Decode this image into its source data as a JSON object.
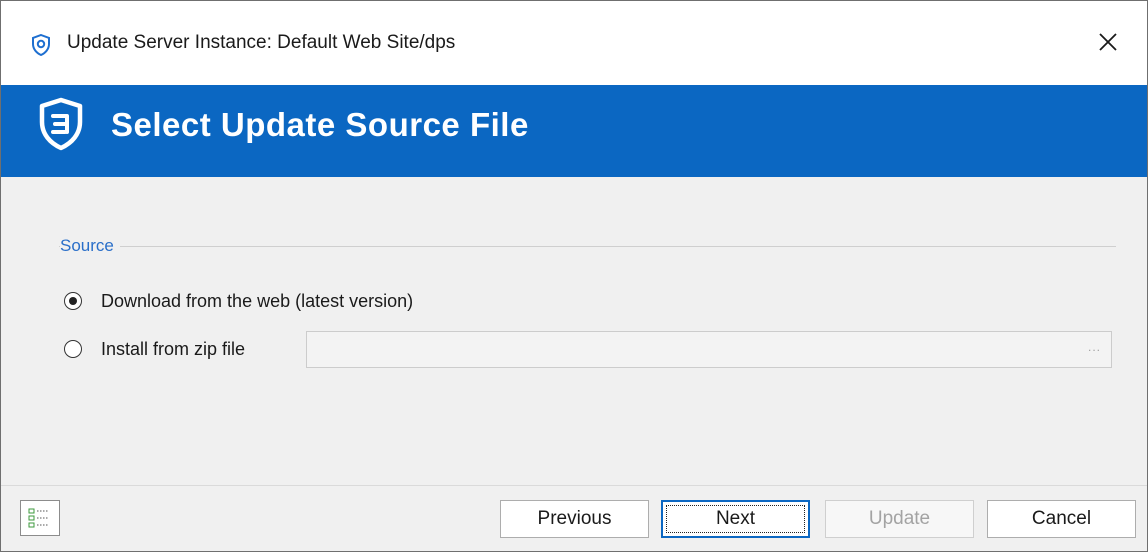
{
  "window": {
    "title": "Update Server Instance: Default Web Site/dps",
    "close_glyph": "✕",
    "title_icon": "shield-icon",
    "accent_color": "#0b67c2"
  },
  "banner": {
    "title": "Select Update Source File",
    "icon": "shield-logo-icon"
  },
  "source_group": {
    "label": "Source",
    "options": [
      {
        "label": "Download from the web (latest version)",
        "selected": true
      },
      {
        "label": "Install from zip file",
        "selected": false
      }
    ],
    "zip_path_value": "",
    "browse_glyph": "..."
  },
  "footer": {
    "checklist_icon": "checklist-icon",
    "buttons": {
      "previous": "Previous",
      "next": "Next",
      "update": "Update",
      "cancel": "Cancel"
    }
  }
}
